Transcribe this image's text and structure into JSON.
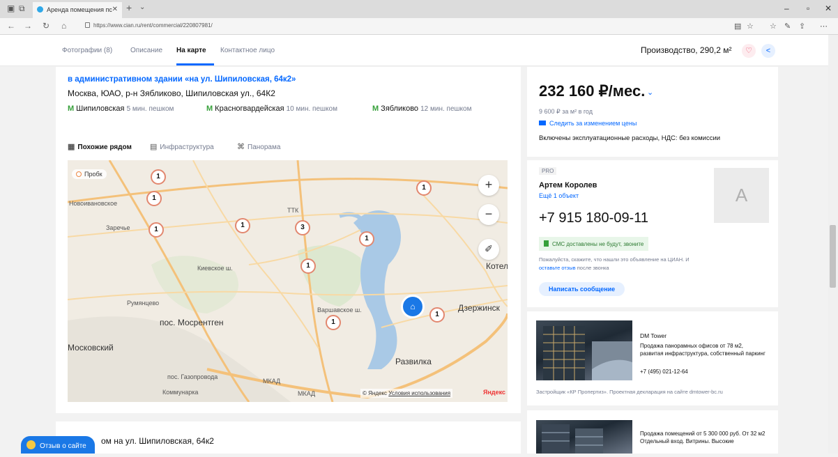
{
  "browser": {
    "tab_title": "Аренда помещения пс",
    "url": "https://www.cian.ru/rent/commercial/220807981/"
  },
  "sitenav": {
    "links": [
      "Фотографии (8)",
      "Описание",
      "На карте",
      "Контактное лицо"
    ],
    "active_index": 2,
    "object_title": "Производство, 290,2 м²"
  },
  "address": {
    "building": "в административном здании «на ул. Шипиловская, 64к2»",
    "full": "Москва, ЮАО, р-н Зябликово, Шипиловская ул., 64К2",
    "metro": [
      {
        "name": "Шипиловская",
        "walk": "5 мин. пешком"
      },
      {
        "name": "Красногвардейская",
        "walk": "10 мин. пешком"
      },
      {
        "name": "Зябликово",
        "walk": "12 мин. пешком"
      }
    ]
  },
  "map": {
    "tabs": [
      "Похожие рядом",
      "Инфраструктура",
      "Панорама"
    ],
    "traffic_label": "Пробк",
    "labels": [
      "Новоивановское",
      "Заречье",
      "Румянцево",
      "пос. Мосрентген",
      "Московский",
      "пос. Газопровода",
      "Коммунарка",
      "Котельн",
      "Дзержинск",
      "Развилка",
      "МКАД",
      "МКАД",
      "ТТК",
      "Варшавское ш.",
      "Киевское ш."
    ],
    "markers": [
      "1",
      "1",
      "1",
      "1",
      "3",
      "1",
      "1",
      "1",
      "1",
      "1"
    ],
    "copyright": "© Яндекс",
    "terms_link": "Условия использования",
    "yandex_logo": "Яндекс"
  },
  "offer": {
    "price": "232 160 ₽/мес.",
    "price_per_sqm": "9 600 ₽ за м² в год",
    "follow_link": "Следить за изменением цены",
    "included": "Включены эксплуатационные расходы, НДС: без комиссии"
  },
  "agent": {
    "badge": "PRO",
    "name": "Артем Королев",
    "more_link": "Ещё 1 объект",
    "avatar_letter": "А",
    "phone": "+7 915 180-09-11",
    "sms_note": "СМС доставлены не будут, звоните",
    "hint_text": "Пожалуйста, скажите, что нашли это объявление на ЦИАН. И",
    "hint_link": "оставьте отзыв",
    "hint_tail": "после звонка",
    "write_button": "Написать сообщение"
  },
  "ads": [
    {
      "title": "DM Tower",
      "desc": "Продажа панорамных офисов от 78 м2, развитая инфраструктура, собственный паркинг",
      "phone": "+7 (495) 021-12-64",
      "footer": "Застройщик «КР Пропертиз». Проектная декларация на сайте dmtower-bc.ru"
    },
    {
      "desc": "Продажа помещений от 5 300 000 руб. От 32 м2 Отдельный вход. Витрины. Высокие"
    }
  ],
  "bottom": {
    "title": "ом на ул. Шипиловская, 64к2",
    "feedback": "Отзыв о сайте"
  }
}
